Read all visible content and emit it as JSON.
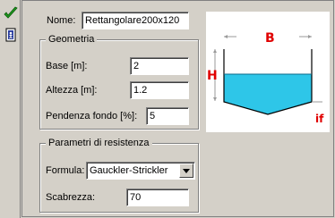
{
  "toolbar": {
    "confirm_icon": "checkmark-icon",
    "exit_icon": "exit-door-icon"
  },
  "name": {
    "label": "Nome:",
    "value": "Rettangolare200x120"
  },
  "geometry": {
    "legend": "Geometria",
    "base_label": "Base [m]:",
    "base_value": "2",
    "height_label": "Altezza [m]:",
    "height_value": "1.2",
    "slope_label": "Pendenza fondo [%]:",
    "slope_value": "5"
  },
  "resistance": {
    "legend": "Parametri di resistenza",
    "formula_label": "Formula:",
    "formula_value": "Gauckler-Strickler",
    "roughness_label": "Scabrezza:",
    "roughness_value": "70"
  },
  "diagram": {
    "labels": {
      "base": "B",
      "height": "H",
      "slope": "if"
    },
    "colors": {
      "water": "#2ec6e8",
      "dimension": "#e00000",
      "wall": "#000000",
      "guide": "#9a9a9a"
    }
  },
  "colors": {
    "window": "#d4d0c8",
    "field": "#ffffff"
  }
}
